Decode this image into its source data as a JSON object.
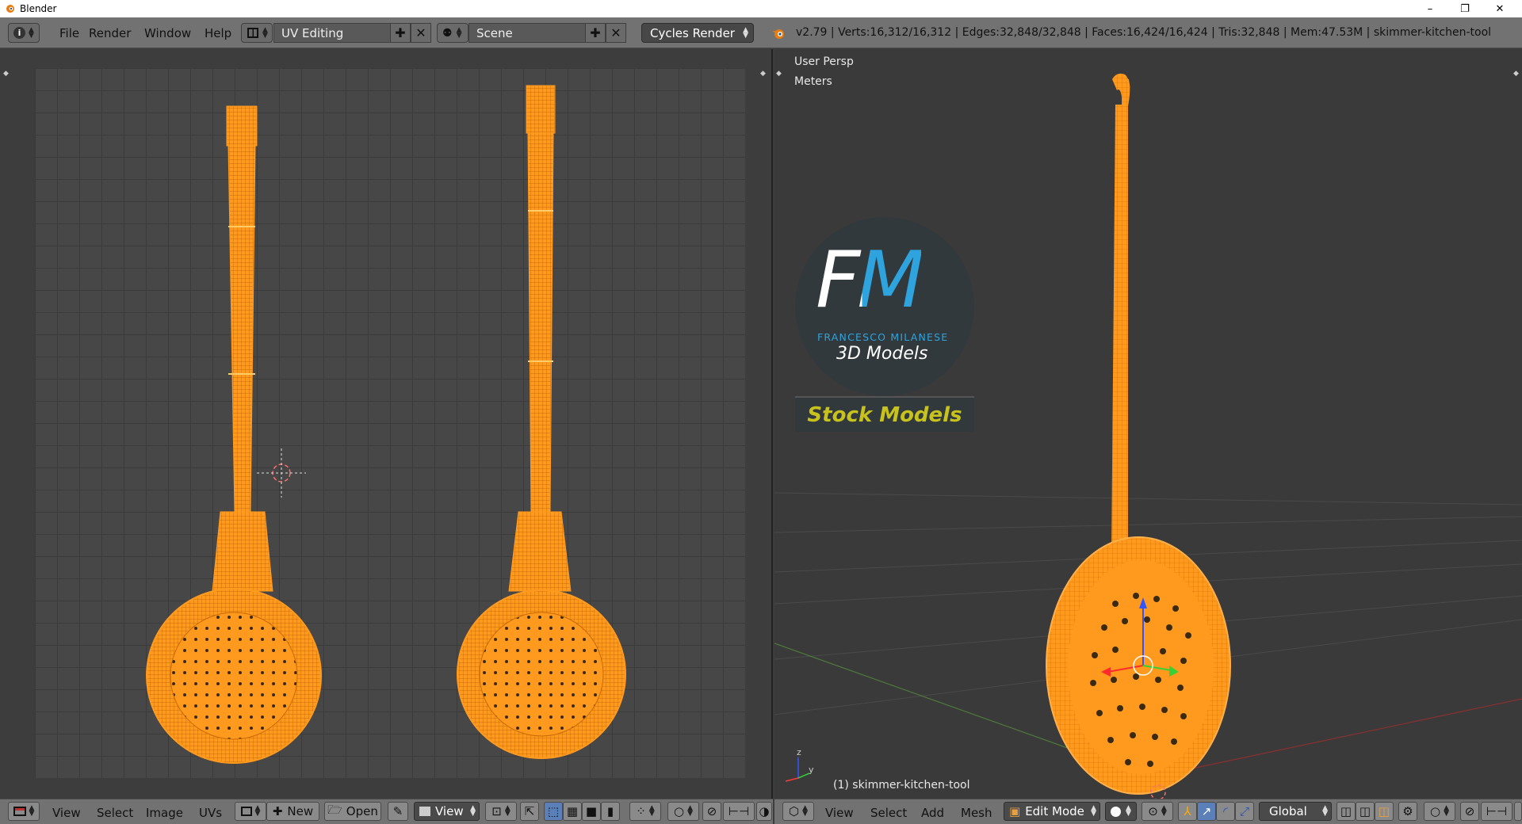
{
  "window": {
    "title": "Blender",
    "minimize": "–",
    "restore": "❐",
    "close": "✕"
  },
  "topbar": {
    "menus": [
      "File",
      "Render",
      "Window",
      "Help"
    ],
    "screen_layout": "UV Editing",
    "scene": "Scene",
    "render_engine": "Cycles Render",
    "stats": "v2.79 | Verts:16,312/16,312 | Edges:32,848/32,848 | Faces:16,424/16,424 | Tris:32,848 | Mem:47.53M | skimmer-kitchen-tool"
  },
  "uv_editor": {
    "menus": [
      "View",
      "Select",
      "Image",
      "UVs"
    ],
    "new_label": "New",
    "open_label": "Open",
    "view_label": "View"
  },
  "viewport": {
    "view_name": "User Persp",
    "units": "Meters",
    "object_label": "(1) skimmer-kitchen-tool",
    "menus": [
      "View",
      "Select",
      "Add",
      "Mesh"
    ],
    "mode": "Edit Mode",
    "orientation": "Global",
    "axis_z": "z",
    "axis_y": "y"
  },
  "watermark": {
    "logo_text": "FM",
    "brand": "FRANCESCO MILANESE",
    "subtitle": "3D Models",
    "tag": "Stock Models"
  },
  "colors": {
    "mesh": "#ff9a1e",
    "wire": "#c96a00",
    "accent_blue": "#2ea3dd",
    "tag_yellow": "#c8c21c"
  }
}
